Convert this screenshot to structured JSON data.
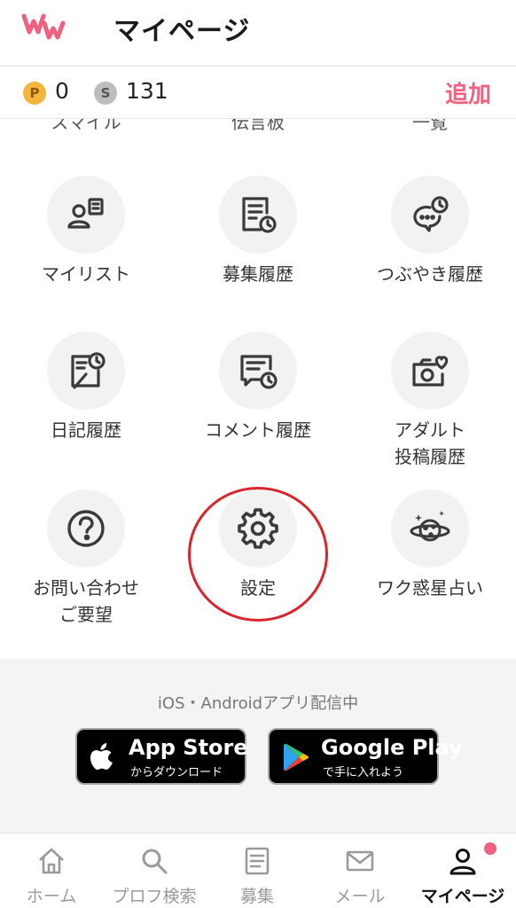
{
  "header": {
    "title": "マイページ",
    "logo_text": "ww"
  },
  "points": {
    "p_symbol": "P",
    "p_value": "0",
    "s_symbol": "S",
    "s_value": "131",
    "add_label": "追加"
  },
  "cut_row": [
    "スマイル",
    "伝言板",
    "一覧"
  ],
  "menu": [
    {
      "label": "マイリスト",
      "icon": "person-list-icon"
    },
    {
      "label": "募集履歴",
      "icon": "document-clock-icon"
    },
    {
      "label": "つぶやき履歴",
      "icon": "chat-clock-icon"
    },
    {
      "label": "日記履歴",
      "icon": "diary-clock-icon"
    },
    {
      "label": "コメント履歴",
      "icon": "comment-clock-icon"
    },
    {
      "label": "アダルト\n投稿履歴",
      "icon": "camera-heart-icon"
    },
    {
      "label": "お問い合わせ\nご要望",
      "icon": "question-icon"
    },
    {
      "label": "設定",
      "icon": "gear-icon"
    },
    {
      "label": "ワク惑星占い",
      "icon": "planet-icon"
    }
  ],
  "app": {
    "caption": "iOS・Androidアプリ配信中",
    "apple_main": "App Store",
    "apple_sub": "からダウンロード",
    "google_main": "Google Play",
    "google_sub": "で手に入れよう"
  },
  "nav": [
    {
      "label": "ホーム",
      "icon": "home-icon"
    },
    {
      "label": "プロフ検索",
      "icon": "search-icon"
    },
    {
      "label": "募集",
      "icon": "list-icon"
    },
    {
      "label": "メール",
      "icon": "mail-icon"
    },
    {
      "label": "マイページ",
      "icon": "user-icon"
    }
  ],
  "colors": {
    "accent": "#f0617f",
    "annotation": "#d9262c",
    "icon": "#3a3a3a"
  }
}
